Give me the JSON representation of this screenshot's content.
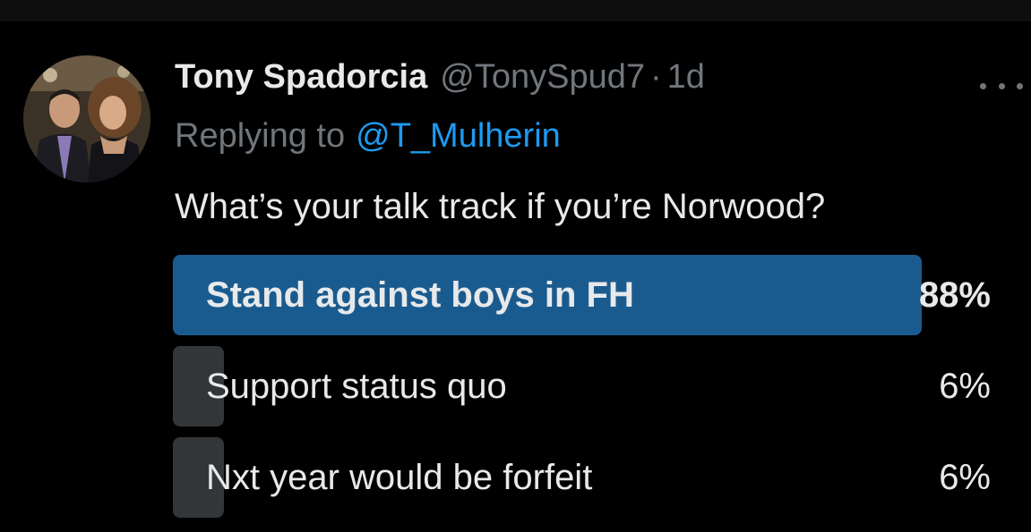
{
  "colors": {
    "background": "#000000",
    "text": "#e7e9ea",
    "secondary_text": "#71767b",
    "link": "#1d9bf0",
    "poll_winner_fill": "#1a5b8f",
    "poll_other_fill": "#333639"
  },
  "tweet": {
    "author_name": "Tony Spadorcia",
    "handle": "@TonySpud7",
    "separator": "·",
    "timestamp": "1d",
    "replying_to_label": "Replying to",
    "replying_to_handle": "@T_Mulherin",
    "text": "What’s your talk track if you’re Norwood?",
    "more_icon": "more-horizontal-icon",
    "avatar_icon": "user-avatar-photo"
  },
  "poll": {
    "options": [
      {
        "label": "Stand against boys in FH",
        "percent_text": "88%",
        "fraction": 0.88,
        "winner": true
      },
      {
        "label": "Support status quo",
        "percent_text": "6%",
        "fraction": 0.06,
        "winner": false
      },
      {
        "label": "Nxt year would be forfeit",
        "percent_text": "6%",
        "fraction": 0.06,
        "winner": false
      }
    ]
  }
}
